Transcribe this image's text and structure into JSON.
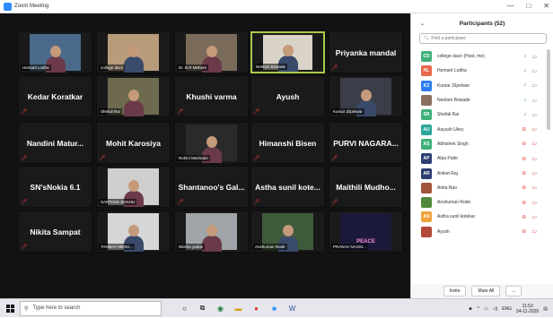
{
  "window": {
    "title": "Zoom Meeting",
    "controls": [
      "—",
      "□",
      "✕"
    ]
  },
  "tiles": [
    {
      "id": "t1",
      "type": "video",
      "label": "Hemant Lodha",
      "bg": "#4b6a8a"
    },
    {
      "id": "t2",
      "type": "video",
      "label": "college dacn",
      "bg": "#b79b7a"
    },
    {
      "id": "t3",
      "type": "video",
      "label": "Dr. B R Mehere",
      "bg": "#7a6a5a"
    },
    {
      "id": "t4",
      "type": "video",
      "label": "Neelam Bowade",
      "bg": "#d9d3c8",
      "active": true
    },
    {
      "id": "t5",
      "type": "name",
      "name": "Priyanka mandal"
    },
    {
      "id": "t6",
      "type": "name",
      "name": "Kedar Koratkar"
    },
    {
      "id": "t7",
      "type": "video",
      "label": "Shefali Rai",
      "bg": "#6d6a4e"
    },
    {
      "id": "t8",
      "type": "name",
      "name": "Khushi varma"
    },
    {
      "id": "t9",
      "type": "name",
      "name": "Ayush"
    },
    {
      "id": "t10",
      "type": "video",
      "label": "Kumar Zilpelwar",
      "bg": "#3b3d48"
    },
    {
      "id": "t11",
      "type": "name",
      "name": "Nandini   Matur..."
    },
    {
      "id": "t12",
      "type": "name",
      "name": "Mohit Karosiya"
    },
    {
      "id": "t13",
      "type": "photo",
      "label": "Rohini Meshram",
      "bg": "#2a2a2a"
    },
    {
      "id": "t14",
      "type": "name",
      "name": "Himanshi Bisen"
    },
    {
      "id": "t15",
      "type": "name",
      "name": "PURVI  NAGARA..."
    },
    {
      "id": "t16",
      "type": "name",
      "name": "SN'sNokia 6.1"
    },
    {
      "id": "t17",
      "type": "photo",
      "label": "SARTHAK SHAHU",
      "bg": "#cfcfcf"
    },
    {
      "id": "t18",
      "type": "name",
      "name": "Shantanoo's Gal..."
    },
    {
      "id": "t19",
      "type": "name",
      "name": "Astha sunil kote..."
    },
    {
      "id": "t20",
      "type": "name",
      "name": "Maithili Mudho..."
    },
    {
      "id": "t21",
      "type": "name",
      "name": "Nikita Sampat"
    },
    {
      "id": "t22",
      "type": "photo",
      "label": "TANMAY MESH...",
      "bg": "#d6d6d6"
    },
    {
      "id": "t23",
      "type": "photo",
      "label": "Nitisha yadav",
      "bg": "#9fa5a8"
    },
    {
      "id": "t24",
      "type": "photo",
      "label": "Anshuman Rode",
      "bg": "#3e5a3a"
    },
    {
      "id": "t25",
      "type": "photo",
      "label": "PRANAV NAGM...",
      "bg": "#1c1a3a",
      "caption": "PEACE"
    }
  ],
  "participants": {
    "title": "Participants (52)",
    "search_placeholder": "Find a participant",
    "list": [
      {
        "initials": "CD",
        "color": "#3fb07a",
        "name": "college dacn (Host, me)",
        "mic": "on",
        "cam": "on"
      },
      {
        "initials": "HL",
        "color": "#e5694a",
        "name": "Hemant Lodha",
        "mic": "on",
        "cam": "on"
      },
      {
        "initials": "KZ",
        "color": "#2d7cf0",
        "name": "Kumar Zilpelwar",
        "mic": "on",
        "cam": "on"
      },
      {
        "initials": "",
        "color": "#8a6e5e",
        "name": "Neelam Bowade",
        "mic": "active",
        "cam": "on",
        "photo": true
      },
      {
        "initials": "SR",
        "color": "#3fb07a",
        "name": "Shefali Rai",
        "mic": "on",
        "cam": "on"
      },
      {
        "initials": "AU",
        "color": "#2aa79a",
        "name": "Aayush Ukey",
        "mic": "off",
        "cam": "off"
      },
      {
        "initials": "AS",
        "color": "#3fb07a",
        "name": "Abhishek Singh",
        "mic": "off",
        "cam": "off"
      },
      {
        "initials": "AP",
        "color": "#2c3e70",
        "name": "Alpa Patle",
        "mic": "off",
        "cam": "off"
      },
      {
        "initials": "AR",
        "color": "#2c3e70",
        "name": "Aniket Raj",
        "mic": "off",
        "cam": "off"
      },
      {
        "initials": "",
        "color": "#a0553a",
        "name": "Anita Rao",
        "mic": "off",
        "cam": "off",
        "photo": true
      },
      {
        "initials": "",
        "color": "#4e8a3a",
        "name": "Anshuman Rode",
        "mic": "off",
        "cam": "off",
        "photo": true
      },
      {
        "initials": "AS",
        "color": "#f0a23a",
        "name": "Astha sunil kotekar",
        "mic": "off",
        "cam": "off"
      },
      {
        "initials": "",
        "color": "#b44a3a",
        "name": "Ayush",
        "mic": "off",
        "cam": "off",
        "photo": true
      }
    ],
    "buttons": {
      "invite": "Invite",
      "mute_all": "Mute All",
      "more": "..."
    }
  },
  "taskbar": {
    "search_placeholder": "Type here to search",
    "lang": "ENG",
    "time": "11:53",
    "date": "24-11-2020"
  }
}
